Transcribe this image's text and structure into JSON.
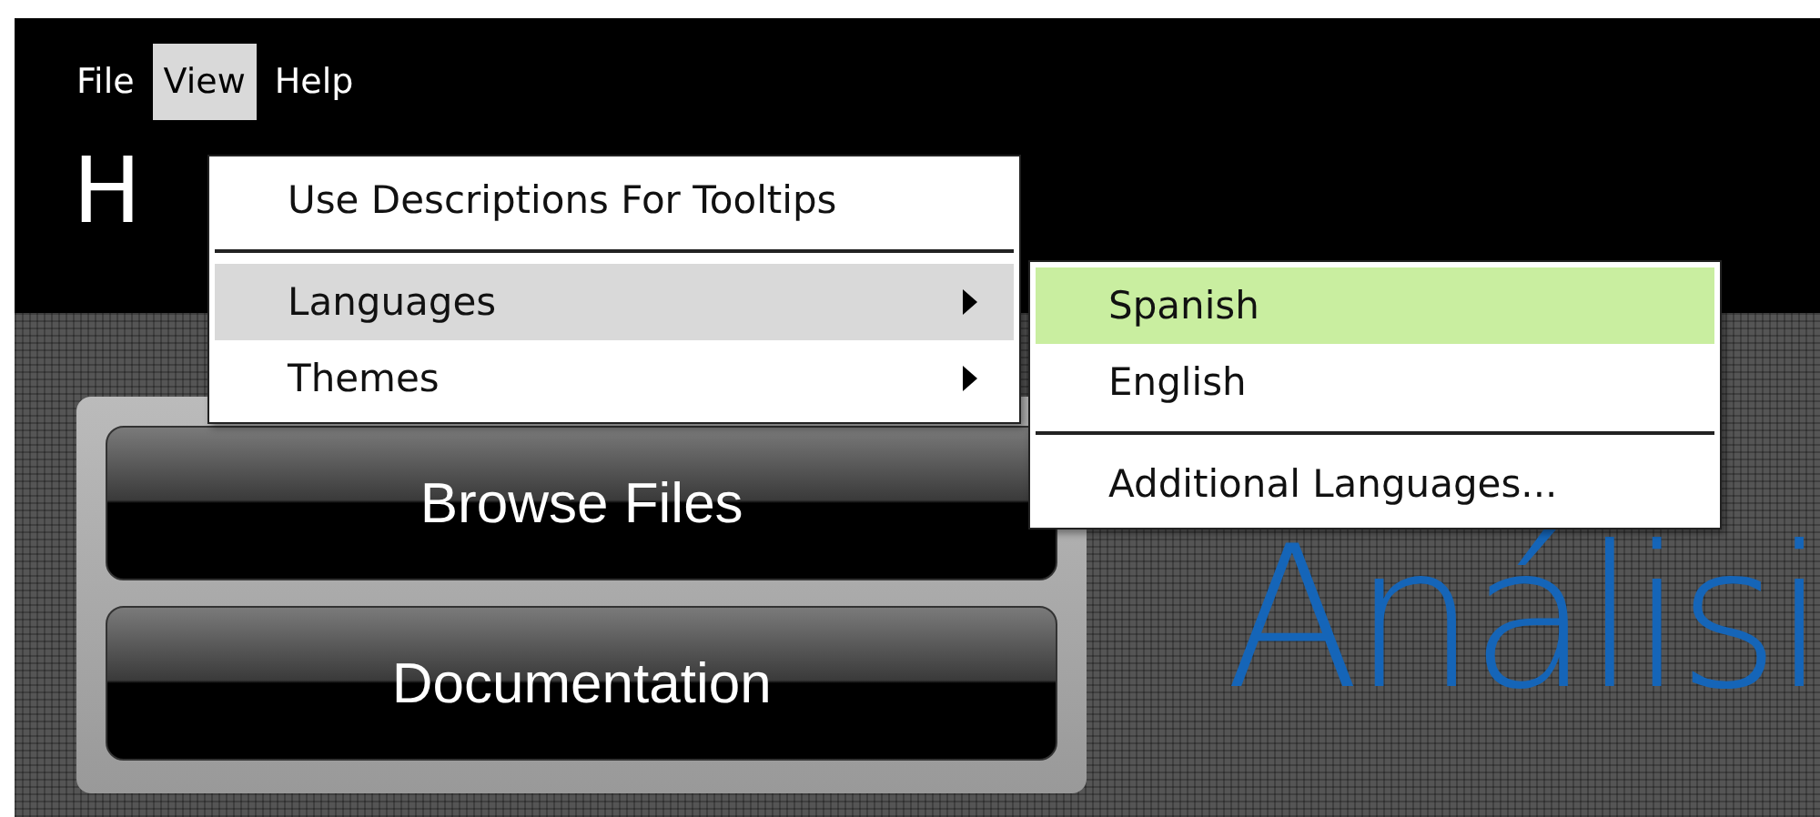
{
  "menubar": [
    {
      "label": "File",
      "selected": false
    },
    {
      "label": "View",
      "selected": true
    },
    {
      "label": "Help",
      "selected": false
    }
  ],
  "title": "H",
  "menu": {
    "items": [
      {
        "kind": "item",
        "label": "Use Descriptions For Tooltips",
        "selected": false
      },
      {
        "kind": "separator"
      },
      {
        "kind": "submenu",
        "label": "Languages",
        "selected": true
      },
      {
        "kind": "submenu",
        "label": "Themes",
        "selected": false
      }
    ]
  },
  "submenu": {
    "items": [
      {
        "kind": "item",
        "label": "Spanish",
        "selected": true
      },
      {
        "kind": "item",
        "label": "English",
        "selected": false
      },
      {
        "kind": "separator"
      },
      {
        "kind": "item",
        "label": "Additional Languages...",
        "selected": false
      }
    ]
  },
  "buttons": [
    "Browse Files",
    "Documentation"
  ],
  "heading": "Análisi"
}
